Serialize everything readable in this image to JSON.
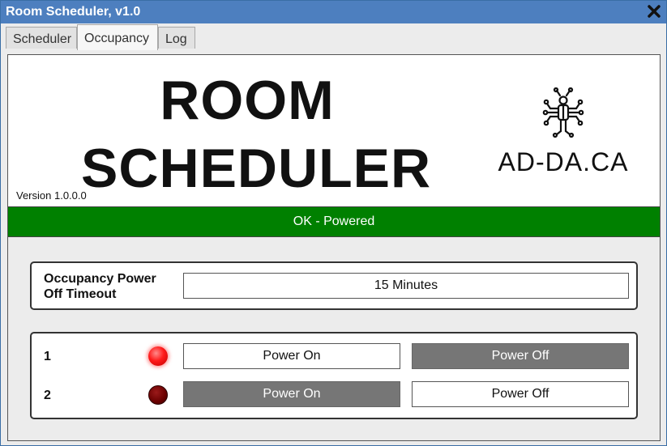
{
  "window": {
    "title": "Room Scheduler, v1.0"
  },
  "tabs": [
    {
      "label": "Scheduler",
      "active": false
    },
    {
      "label": "Occupancy",
      "active": true
    },
    {
      "label": "Log",
      "active": false
    }
  ],
  "header": {
    "title_line1": "ROOM",
    "title_line2": "SCHEDULER",
    "version": "Version 1.0.0.0",
    "logo_text": "AD-DA.CA"
  },
  "status": {
    "text": "OK - Powered",
    "color": "#008000"
  },
  "timeout": {
    "label": "Occupancy Power Off Timeout",
    "value": "15 Minutes"
  },
  "rooms": [
    {
      "number": "1",
      "led": "on",
      "power_on_label": "Power On",
      "power_off_label": "Power Off",
      "active": "on"
    },
    {
      "number": "2",
      "led": "off",
      "power_on_label": "Power On",
      "power_off_label": "Power Off",
      "active": "off"
    }
  ],
  "icons": {
    "close": "close-icon",
    "logo": "circuit-person-icon"
  }
}
